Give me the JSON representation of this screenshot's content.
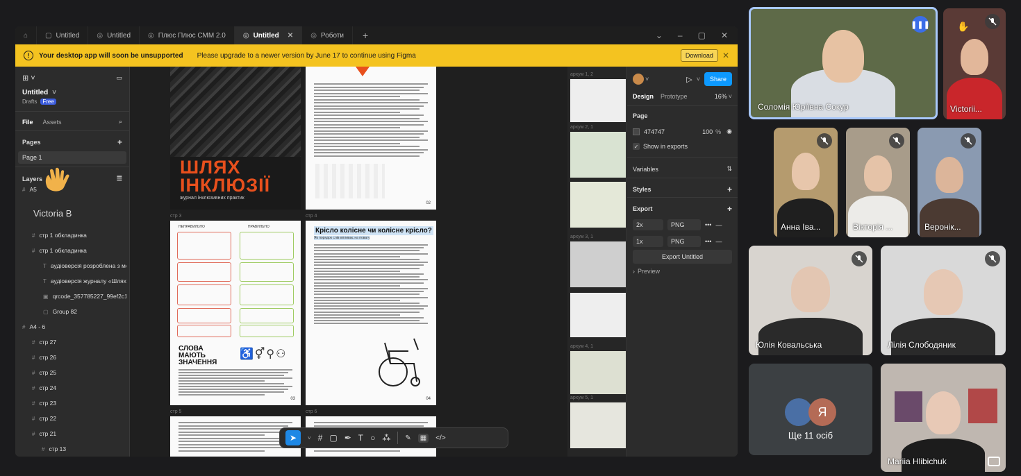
{
  "figma": {
    "tabs": [
      {
        "label": "Untitled",
        "icon": "home-icon"
      },
      {
        "label": "Untitled",
        "icon": "file-icon"
      },
      {
        "label": "Untitled",
        "icon": "figjam-icon"
      },
      {
        "label": "Плюс Плюс СММ 2.0",
        "icon": "figjam-icon"
      },
      {
        "label": "Untitled",
        "icon": "figjam-icon",
        "active": true
      },
      {
        "label": "Роботи",
        "icon": "figjam-icon"
      }
    ],
    "banner": {
      "title": "Your desktop app will soon be unsupported",
      "message": "Please upgrade to a newer version by June 17 to continue using Figma",
      "button": "Download"
    },
    "left": {
      "file_name": "Untitled",
      "drafts": "Drafts",
      "plan": "Free",
      "tab_file": "File",
      "tab_assets": "Assets",
      "pages_label": "Pages",
      "page_item": "Page 1",
      "layers_label": "Layers",
      "cursor_name": "Victoria B",
      "layers": [
        {
          "label": "A5",
          "kind": "frame"
        },
        {
          "label": "стр 1 обкладинка",
          "kind": "frame"
        },
        {
          "label": "стр 1 обкладинка",
          "kind": "frame"
        },
        {
          "label": "стр 1 обкладинка",
          "kind": "frame"
        },
        {
          "label": "стр 1 обкладинка",
          "kind": "frame"
        },
        {
          "label": "аудіоверсія розроблена з ме",
          "kind": "text"
        },
        {
          "label": "аудіоверсія журналу «Шлях",
          "kind": "text"
        },
        {
          "label": "qrcode_357785227_99ef2c1b",
          "kind": "image"
        },
        {
          "label": "Group 82",
          "kind": "group"
        },
        {
          "label": "A4 - 6",
          "kind": "frame"
        },
        {
          "label": "стр 27",
          "kind": "frame"
        },
        {
          "label": "стр 26",
          "kind": "frame"
        },
        {
          "label": "стр 25",
          "kind": "frame"
        },
        {
          "label": "стр 24",
          "kind": "frame"
        },
        {
          "label": "стр 23",
          "kind": "frame"
        },
        {
          "label": "стр 22",
          "kind": "frame"
        },
        {
          "label": "стр 21",
          "kind": "frame"
        },
        {
          "label": "стр 13",
          "kind": "frame"
        }
      ]
    },
    "canvas": {
      "cover_title_1": "ШЛЯХ",
      "cover_title_2": "ІНКЛЮЗІЇ",
      "cover_subtitle": "журнал інклюзивних практик",
      "page3_label": "стр 3",
      "page4_label": "стр 4",
      "page5_label": "стр 5",
      "page6_label": "стр 6",
      "heading_words": "СЛОВА МАЮТЬ ЗНАЧЕННЯ",
      "heading_chair": "Крісло колісне чи колісне крісло?",
      "chair_sub": "Як порядок слів впливає на повагу",
      "page_no_02": "02",
      "page_no_03": "03",
      "page_no_04": "04",
      "col_left": "НЕПРАВИЛЬНО",
      "col_right": "ПРАВИЛЬНО",
      "thumb_labels": [
        "архум 1, 2",
        "архум 2, 1",
        "архум 3, 1",
        "архум 4, 1",
        "архум 5, 1"
      ]
    },
    "right": {
      "tab_design": "Design",
      "tab_prototype": "Prototype",
      "zoom": "16%",
      "share": "Share",
      "page_label": "Page",
      "color_hex": "474747",
      "opacity": "100",
      "opacity_unit": "%",
      "show_exports": "Show in exports",
      "variables": "Variables",
      "styles": "Styles",
      "export": "Export",
      "export_rows": [
        {
          "scale": "2x",
          "format": "PNG"
        },
        {
          "scale": "1x",
          "format": "PNG"
        }
      ],
      "export_button": "Export Untitled",
      "preview": "Preview"
    }
  },
  "meet": {
    "tiles": [
      {
        "name": "Соломія Юріївна Сокур",
        "speaking": true
      },
      {
        "name": "Victorii...",
        "muted": true
      },
      {
        "name": "Анна Іва...",
        "muted": true
      },
      {
        "name": "Вікторія ...",
        "muted": true
      },
      {
        "name": "Веронік...",
        "muted": true
      },
      {
        "name": "Юлія Ковальська",
        "muted": true
      },
      {
        "name": "Лілія Слободяник",
        "muted": true
      },
      {
        "name": "Ще 11 осіб",
        "avatar_letter": "Я"
      },
      {
        "name": "Mariia Hlibichuk"
      }
    ]
  }
}
